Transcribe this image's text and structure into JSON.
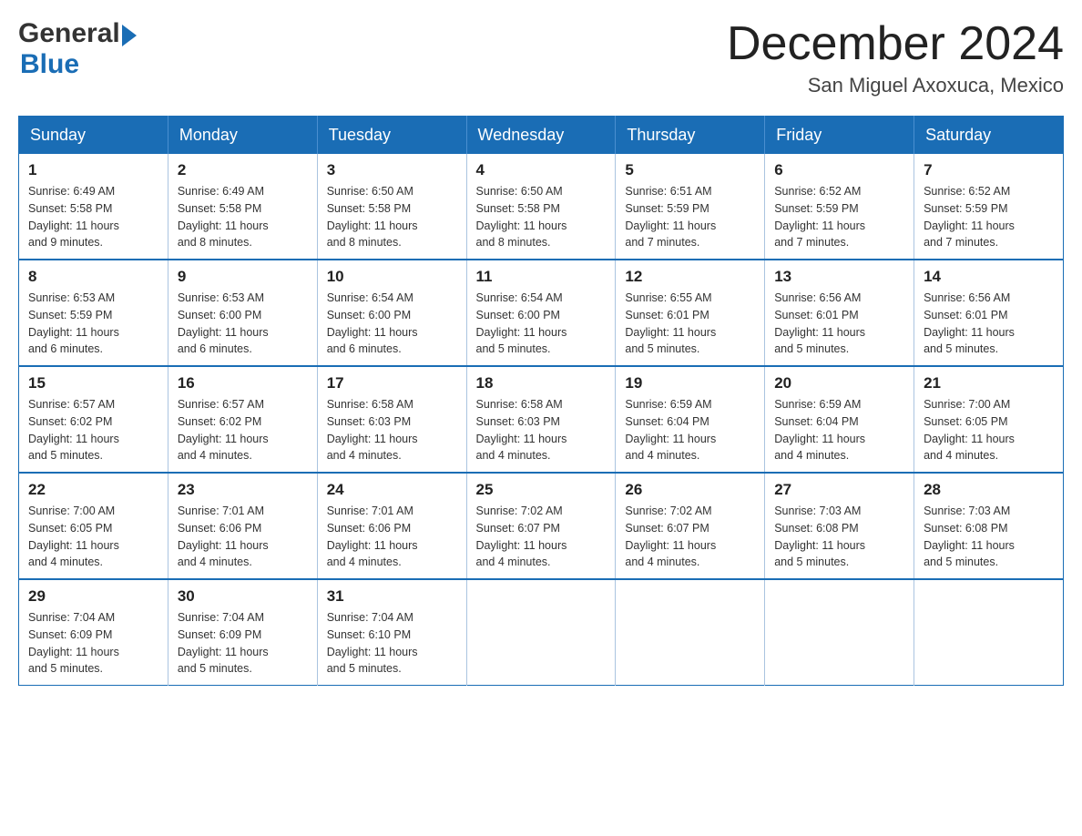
{
  "header": {
    "logo_general": "General",
    "logo_blue": "Blue",
    "month_title": "December 2024",
    "location": "San Miguel Axoxuca, Mexico"
  },
  "weekdays": [
    "Sunday",
    "Monday",
    "Tuesday",
    "Wednesday",
    "Thursday",
    "Friday",
    "Saturday"
  ],
  "weeks": [
    [
      {
        "day": "1",
        "info": "Sunrise: 6:49 AM\nSunset: 5:58 PM\nDaylight: 11 hours\nand 9 minutes."
      },
      {
        "day": "2",
        "info": "Sunrise: 6:49 AM\nSunset: 5:58 PM\nDaylight: 11 hours\nand 8 minutes."
      },
      {
        "day": "3",
        "info": "Sunrise: 6:50 AM\nSunset: 5:58 PM\nDaylight: 11 hours\nand 8 minutes."
      },
      {
        "day": "4",
        "info": "Sunrise: 6:50 AM\nSunset: 5:58 PM\nDaylight: 11 hours\nand 8 minutes."
      },
      {
        "day": "5",
        "info": "Sunrise: 6:51 AM\nSunset: 5:59 PM\nDaylight: 11 hours\nand 7 minutes."
      },
      {
        "day": "6",
        "info": "Sunrise: 6:52 AM\nSunset: 5:59 PM\nDaylight: 11 hours\nand 7 minutes."
      },
      {
        "day": "7",
        "info": "Sunrise: 6:52 AM\nSunset: 5:59 PM\nDaylight: 11 hours\nand 7 minutes."
      }
    ],
    [
      {
        "day": "8",
        "info": "Sunrise: 6:53 AM\nSunset: 5:59 PM\nDaylight: 11 hours\nand 6 minutes."
      },
      {
        "day": "9",
        "info": "Sunrise: 6:53 AM\nSunset: 6:00 PM\nDaylight: 11 hours\nand 6 minutes."
      },
      {
        "day": "10",
        "info": "Sunrise: 6:54 AM\nSunset: 6:00 PM\nDaylight: 11 hours\nand 6 minutes."
      },
      {
        "day": "11",
        "info": "Sunrise: 6:54 AM\nSunset: 6:00 PM\nDaylight: 11 hours\nand 5 minutes."
      },
      {
        "day": "12",
        "info": "Sunrise: 6:55 AM\nSunset: 6:01 PM\nDaylight: 11 hours\nand 5 minutes."
      },
      {
        "day": "13",
        "info": "Sunrise: 6:56 AM\nSunset: 6:01 PM\nDaylight: 11 hours\nand 5 minutes."
      },
      {
        "day": "14",
        "info": "Sunrise: 6:56 AM\nSunset: 6:01 PM\nDaylight: 11 hours\nand 5 minutes."
      }
    ],
    [
      {
        "day": "15",
        "info": "Sunrise: 6:57 AM\nSunset: 6:02 PM\nDaylight: 11 hours\nand 5 minutes."
      },
      {
        "day": "16",
        "info": "Sunrise: 6:57 AM\nSunset: 6:02 PM\nDaylight: 11 hours\nand 4 minutes."
      },
      {
        "day": "17",
        "info": "Sunrise: 6:58 AM\nSunset: 6:03 PM\nDaylight: 11 hours\nand 4 minutes."
      },
      {
        "day": "18",
        "info": "Sunrise: 6:58 AM\nSunset: 6:03 PM\nDaylight: 11 hours\nand 4 minutes."
      },
      {
        "day": "19",
        "info": "Sunrise: 6:59 AM\nSunset: 6:04 PM\nDaylight: 11 hours\nand 4 minutes."
      },
      {
        "day": "20",
        "info": "Sunrise: 6:59 AM\nSunset: 6:04 PM\nDaylight: 11 hours\nand 4 minutes."
      },
      {
        "day": "21",
        "info": "Sunrise: 7:00 AM\nSunset: 6:05 PM\nDaylight: 11 hours\nand 4 minutes."
      }
    ],
    [
      {
        "day": "22",
        "info": "Sunrise: 7:00 AM\nSunset: 6:05 PM\nDaylight: 11 hours\nand 4 minutes."
      },
      {
        "day": "23",
        "info": "Sunrise: 7:01 AM\nSunset: 6:06 PM\nDaylight: 11 hours\nand 4 minutes."
      },
      {
        "day": "24",
        "info": "Sunrise: 7:01 AM\nSunset: 6:06 PM\nDaylight: 11 hours\nand 4 minutes."
      },
      {
        "day": "25",
        "info": "Sunrise: 7:02 AM\nSunset: 6:07 PM\nDaylight: 11 hours\nand 4 minutes."
      },
      {
        "day": "26",
        "info": "Sunrise: 7:02 AM\nSunset: 6:07 PM\nDaylight: 11 hours\nand 4 minutes."
      },
      {
        "day": "27",
        "info": "Sunrise: 7:03 AM\nSunset: 6:08 PM\nDaylight: 11 hours\nand 5 minutes."
      },
      {
        "day": "28",
        "info": "Sunrise: 7:03 AM\nSunset: 6:08 PM\nDaylight: 11 hours\nand 5 minutes."
      }
    ],
    [
      {
        "day": "29",
        "info": "Sunrise: 7:04 AM\nSunset: 6:09 PM\nDaylight: 11 hours\nand 5 minutes."
      },
      {
        "day": "30",
        "info": "Sunrise: 7:04 AM\nSunset: 6:09 PM\nDaylight: 11 hours\nand 5 minutes."
      },
      {
        "day": "31",
        "info": "Sunrise: 7:04 AM\nSunset: 6:10 PM\nDaylight: 11 hours\nand 5 minutes."
      },
      {
        "day": "",
        "info": ""
      },
      {
        "day": "",
        "info": ""
      },
      {
        "day": "",
        "info": ""
      },
      {
        "day": "",
        "info": ""
      }
    ]
  ]
}
